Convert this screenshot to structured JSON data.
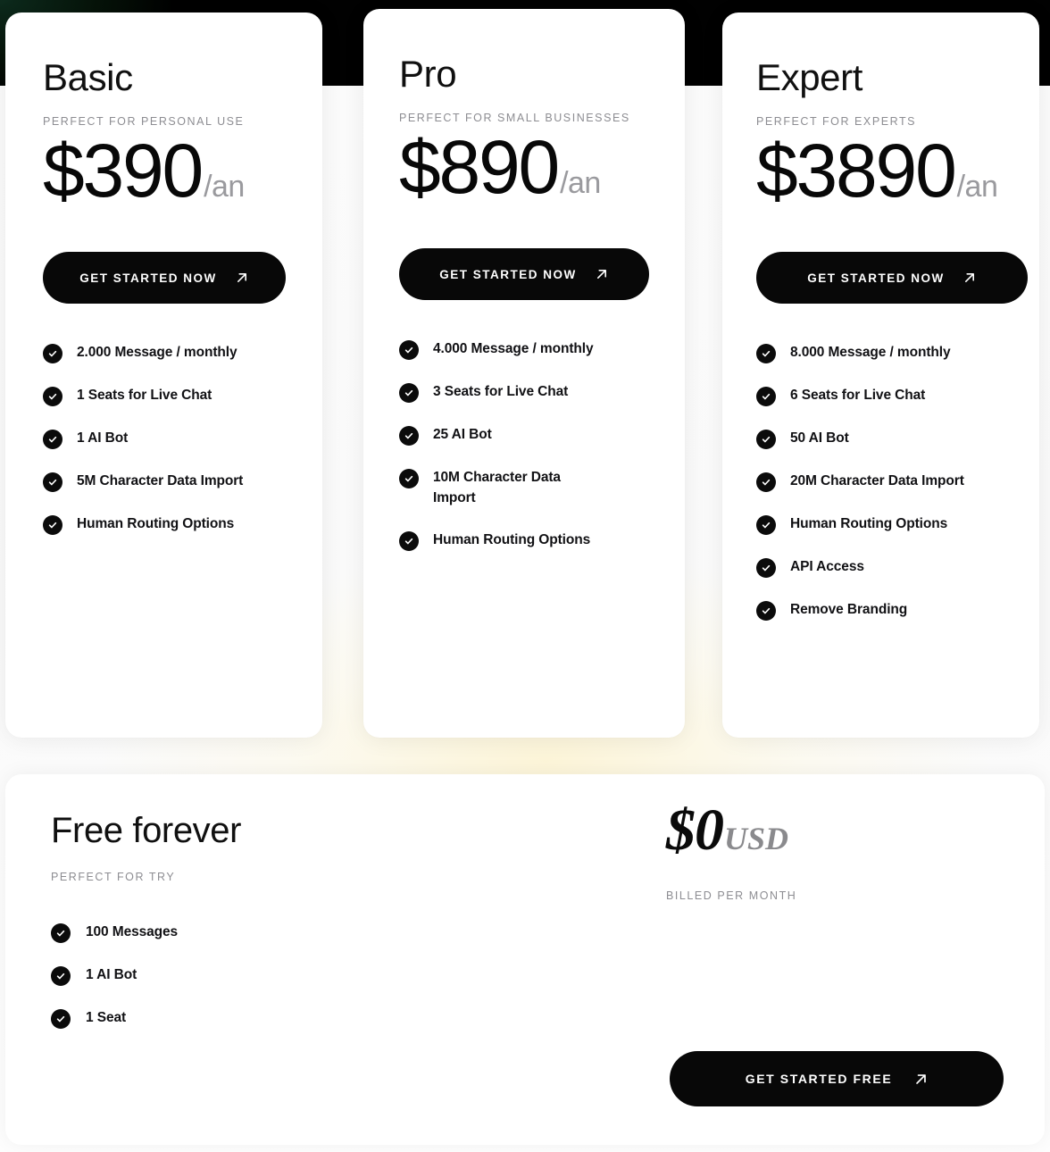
{
  "background": {
    "band_color": "#000000",
    "glow_color": "#0d2b1d",
    "page_glow": "#fcf4d6"
  },
  "icons": {
    "check": "check-icon",
    "arrow": "arrow-up-right-icon"
  },
  "plans": [
    {
      "name": "Basic",
      "tagline": "PERFECT FOR PERSONAL USE",
      "price": "$390",
      "period": "/an",
      "cta": "GET STARTED NOW",
      "features": [
        "2.000 Message / monthly",
        "1 Seats for Live Chat",
        "1 AI Bot",
        "5M Character Data Import",
        "Human Routing Options"
      ]
    },
    {
      "name": "Pro",
      "tagline": "PERFECT FOR SMALL BUSINESSES",
      "price": "$890",
      "period": "/an",
      "cta": "GET STARTED NOW",
      "features": [
        "4.000 Message / monthly",
        "3 Seats for Live Chat",
        "25 AI Bot",
        "10M Character Data Import",
        "Human Routing Options"
      ]
    },
    {
      "name": "Expert",
      "tagline": "PERFECT FOR EXPERTS",
      "price": "$3890",
      "period": "/an",
      "cta": "GET STARTED NOW",
      "features": [
        "8.000 Message / monthly",
        "6 Seats for Live Chat",
        "50 AI Bot",
        "20M Character Data Import",
        "Human Routing Options",
        "API Access",
        "Remove Branding"
      ]
    }
  ],
  "free_plan": {
    "name": "Free forever",
    "tagline": "PERFECT FOR TRY",
    "price": "$0",
    "currency": "USD",
    "billing_note": "BILLED PER MONTH",
    "cta": "GET STARTED FREE",
    "features": [
      "100 Messages",
      "1 AI Bot",
      "1 Seat"
    ]
  }
}
